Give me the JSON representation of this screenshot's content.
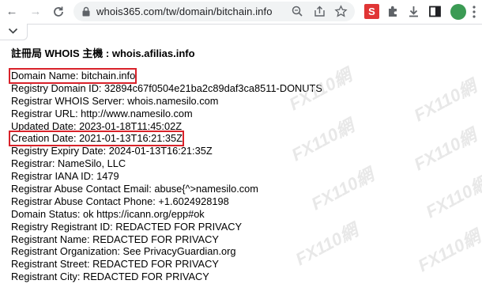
{
  "browser": {
    "url": "whois365.com/tw/domain/bitchain.info",
    "extension_label": "S",
    "back_glyph": "←",
    "forward_glyph": "→",
    "reload_glyph": "C"
  },
  "page": {
    "heading": "註冊局 WHOIS 主機 : whois.afilias.info",
    "records": [
      {
        "text": "Domain Name: bitchain.info",
        "highlight": true
      },
      {
        "text": "Registry Domain ID: 32894c67f0504e21ba2c89daf3ca8511-DONUTS",
        "highlight": false
      },
      {
        "text": "Registrar WHOIS Server: whois.namesilo.com",
        "highlight": false
      },
      {
        "text": "Registrar URL: http://www.namesilo.com",
        "highlight": false
      },
      {
        "text": "Updated Date: 2023-01-18T11:45:02Z",
        "highlight": false
      },
      {
        "text": "Creation Date: 2021-01-13T16:21:35Z",
        "highlight": true
      },
      {
        "text": "Registry Expiry Date: 2024-01-13T16:21:35Z",
        "highlight": false
      },
      {
        "text": "Registrar: NameSilo, LLC",
        "highlight": false
      },
      {
        "text": "Registrar IANA ID: 1479",
        "highlight": false
      },
      {
        "text": "Registrar Abuse Contact Email: abuse{^>namesilo.com",
        "highlight": false
      },
      {
        "text": "Registrar Abuse Contact Phone: +1.6024928198",
        "highlight": false
      },
      {
        "text": "Domain Status: ok https://icann.org/epp#ok",
        "highlight": false
      },
      {
        "text": "Registry Registrant ID: REDACTED FOR PRIVACY",
        "highlight": false
      },
      {
        "text": "Registrant Name: REDACTED FOR PRIVACY",
        "highlight": false
      },
      {
        "text": "Registrant Organization: See PrivacyGuardian.org",
        "highlight": false
      },
      {
        "text": "Registrant Street: REDACTED FOR PRIVACY",
        "highlight": false
      },
      {
        "text": "Registrant City: REDACTED FOR PRIVACY",
        "highlight": false
      }
    ],
    "watermark_text": "FX110網"
  },
  "colors": {
    "highlight_border": "#d9222a",
    "extension_bg": "#e03535",
    "avatar_bg": "#3b9b54"
  },
  "icons": [
    "back-arrow-icon",
    "forward-arrow-icon",
    "reload-icon",
    "lock-icon",
    "zoom-icon",
    "share-icon",
    "star-icon",
    "puzzle-icon",
    "download-icon",
    "side-panel-icon",
    "kebab-menu-icon",
    "chevron-down-icon"
  ]
}
